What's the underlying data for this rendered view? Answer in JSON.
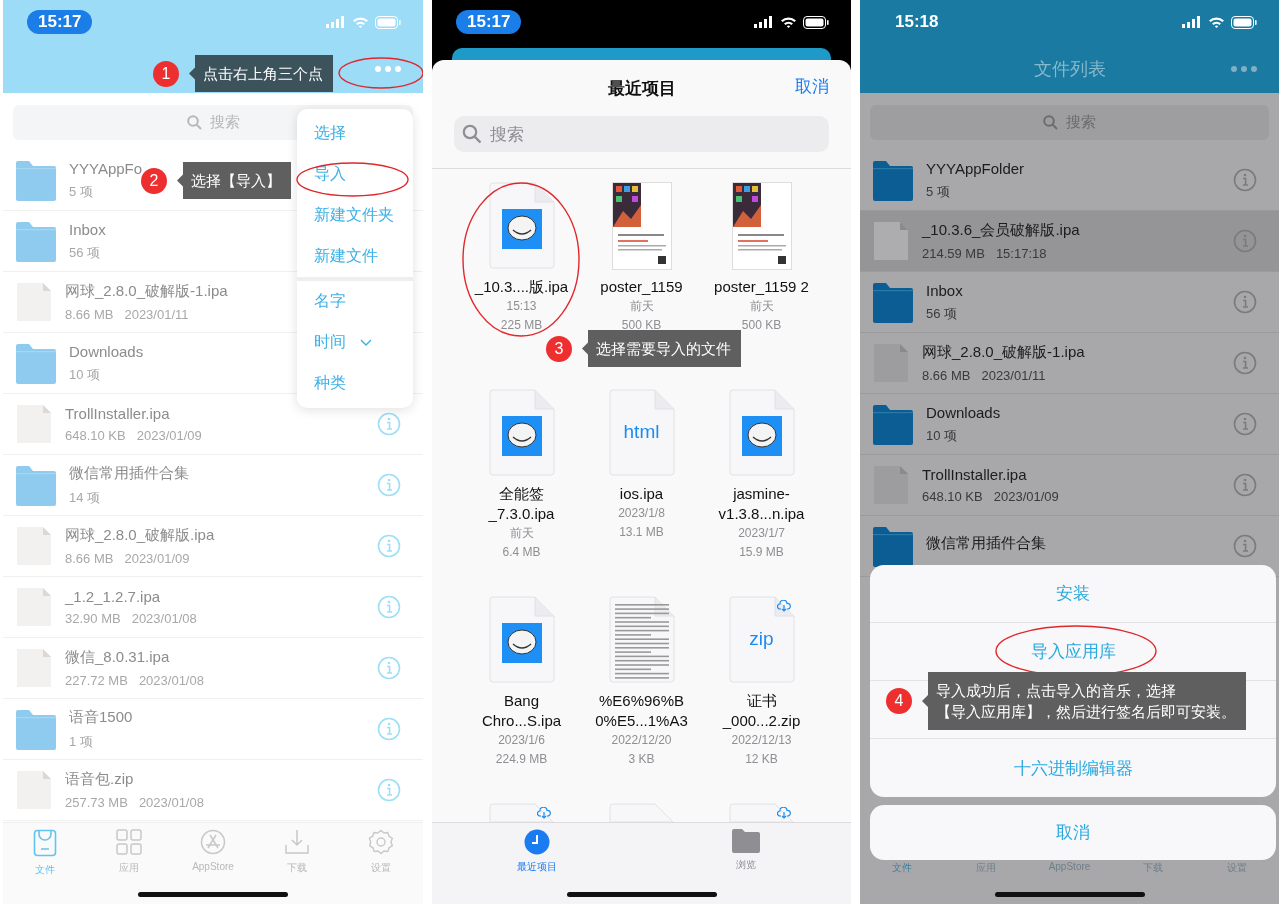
{
  "screens": [
    {
      "kind": "file_list",
      "dimmed": false,
      "status": {
        "time": "15:17",
        "time_pill": true
      },
      "search": {
        "placeholder": "搜索"
      },
      "rows": [
        {
          "kind": "folder",
          "name": "YYYAppFo",
          "count": "5 项",
          "selected": false
        },
        {
          "kind": "folder",
          "name": "Inbox",
          "count": "56 项",
          "selected": false
        },
        {
          "kind": "file",
          "name": "网球_2.8.0_破解版-1.ipa",
          "size": "8.66 MB",
          "date": "2023/01/11",
          "selected": false
        },
        {
          "kind": "folder",
          "name": "Downloads",
          "count": "10 项",
          "selected": false
        },
        {
          "kind": "file",
          "name": "TrollInstaller.ipa",
          "size": "648.10 KB",
          "date": "2023/01/09",
          "selected": false
        },
        {
          "kind": "folder",
          "name": "微信常用插件合集",
          "count": "14 项",
          "selected": false
        },
        {
          "kind": "file",
          "name": "网球_2.8.0_破解版.ipa",
          "size": "8.66 MB",
          "date": "2023/01/09",
          "selected": false
        },
        {
          "kind": "file",
          "name": "_1.2_1.2.7.ipa",
          "size": "32.90 MB",
          "date": "2023/01/08",
          "selected": false
        },
        {
          "kind": "file",
          "name": "微信_8.0.31.ipa",
          "size": "227.72 MB",
          "date": "2023/01/08",
          "selected": false
        },
        {
          "kind": "folder",
          "name": "语音1500",
          "count": "1 项",
          "selected": false
        },
        {
          "kind": "file",
          "name": "语音包.zip",
          "size": "257.73 MB",
          "date": "2023/01/08",
          "selected": false
        }
      ],
      "menu": {
        "groups": [
          [
            {
              "label": "选择",
              "submenu": false
            },
            {
              "label": "导入",
              "submenu": false
            },
            {
              "label": "新建文件夹",
              "submenu": false
            },
            {
              "label": "新建文件",
              "submenu": false
            }
          ],
          [
            {
              "label": "名字",
              "submenu": false
            },
            {
              "label": "时间",
              "submenu": true
            },
            {
              "label": "种类",
              "submenu": false
            }
          ]
        ]
      },
      "tabs": [
        {
          "label": "文件",
          "selected": true
        },
        {
          "label": "应用",
          "selected": false
        },
        {
          "label": "AppStore",
          "selected": false
        },
        {
          "label": "下载",
          "selected": false
        },
        {
          "label": "设置",
          "selected": false
        }
      ],
      "callouts": [
        {
          "number": "1",
          "lines": [
            "点击右上角三个点"
          ]
        },
        {
          "number": "2",
          "lines": [
            "选择【导入】"
          ]
        }
      ]
    },
    {
      "kind": "picker",
      "status": {
        "time": "15:17",
        "time_pill": true
      },
      "title": "最近项目",
      "cancel": "取消",
      "search": {
        "placeholder": "搜索"
      },
      "items": [
        {
          "kind": "app",
          "name": "_10.3....版.ipa",
          "date": "15:13",
          "size": "225 MB",
          "cloud": false
        },
        {
          "kind": "poster",
          "name": "poster_1159",
          "date": "前天",
          "size": "500 KB",
          "cloud": false
        },
        {
          "kind": "poster",
          "name": "poster_1159 2",
          "date": "前天",
          "size": "500 KB",
          "cloud": false
        },
        {
          "kind": "app",
          "name": "全能签\n_7.3.0.ipa",
          "date": "前天",
          "size": "6.4 MB",
          "cloud": false
        },
        {
          "kind": "type",
          "label": "html",
          "name": "ios.ipa",
          "date": "2023/1/8",
          "size": "13.1 MB",
          "cloud": false
        },
        {
          "kind": "app",
          "name": "jasmine-\nv1.3.8...n.ipa",
          "date": "2023/1/7",
          "size": "15.9 MB",
          "cloud": false
        },
        {
          "kind": "app",
          "name": "Bang\nChro...S.ipa",
          "date": "2023/1/6",
          "size": "224.9 MB",
          "cloud": false
        },
        {
          "kind": "text",
          "name": "%E6%96%B\n0%E5...1%A3",
          "date": "2022/12/20",
          "size": "3 KB",
          "cloud": false
        },
        {
          "kind": "type",
          "label": "zip",
          "name": "证书\n_000...2.zip",
          "date": "2022/12/13",
          "size": "12 KB",
          "cloud": true
        },
        {
          "kind": "stub",
          "cloud": true
        },
        {
          "kind": "stub",
          "cloud": false
        },
        {
          "kind": "stub",
          "cloud": true
        }
      ],
      "tabs": [
        {
          "label": "最近项目",
          "selected": true
        },
        {
          "label": "浏览",
          "selected": false
        }
      ],
      "callouts": [
        {
          "number": "3",
          "lines": [
            "选择需要导入的文件"
          ]
        }
      ]
    },
    {
      "kind": "file_list",
      "dimmed": true,
      "status": {
        "time": "15:18",
        "time_pill": false
      },
      "title": "文件列表",
      "search": {
        "placeholder": "搜索"
      },
      "rows": [
        {
          "kind": "folder",
          "name": "YYYAppFolder",
          "count": "5 项",
          "selected": false
        },
        {
          "kind": "file",
          "name": "_10.3.6_会员破解版.ipa",
          "size": "214.59 MB",
          "date": "15:17:18",
          "selected": true
        },
        {
          "kind": "folder",
          "name": "Inbox",
          "count": "56 项",
          "selected": false
        },
        {
          "kind": "file",
          "name": "网球_2.8.0_破解版-1.ipa",
          "size": "8.66 MB",
          "date": "2023/01/11",
          "selected": false
        },
        {
          "kind": "folder",
          "name": "Downloads",
          "count": "10 项",
          "selected": false
        },
        {
          "kind": "file",
          "name": "TrollInstaller.ipa",
          "size": "648.10 KB",
          "date": "2023/01/09",
          "selected": false
        },
        {
          "kind": "folder",
          "name": "微信常用插件合集",
          "selected": false
        }
      ],
      "tabs": [
        {
          "label": "文件",
          "selected": true
        },
        {
          "label": "应用",
          "selected": false
        },
        {
          "label": "AppStore",
          "selected": false
        },
        {
          "label": "下载",
          "selected": false
        },
        {
          "label": "设置",
          "selected": false
        }
      ],
      "sheet": {
        "actions": [
          {
            "kind": "action",
            "label": "安装"
          },
          {
            "kind": "action",
            "label": "导入应用库"
          },
          {
            "kind": "covered"
          },
          {
            "kind": "action",
            "label": "十六进制编辑器"
          }
        ],
        "cancel": "取消"
      },
      "callouts": [
        {
          "number": "4",
          "lines": [
            "导入成功后，点击导入的音乐，选择",
            "【导入应用库】，然后进行签名后即可安装。"
          ]
        }
      ]
    }
  ]
}
